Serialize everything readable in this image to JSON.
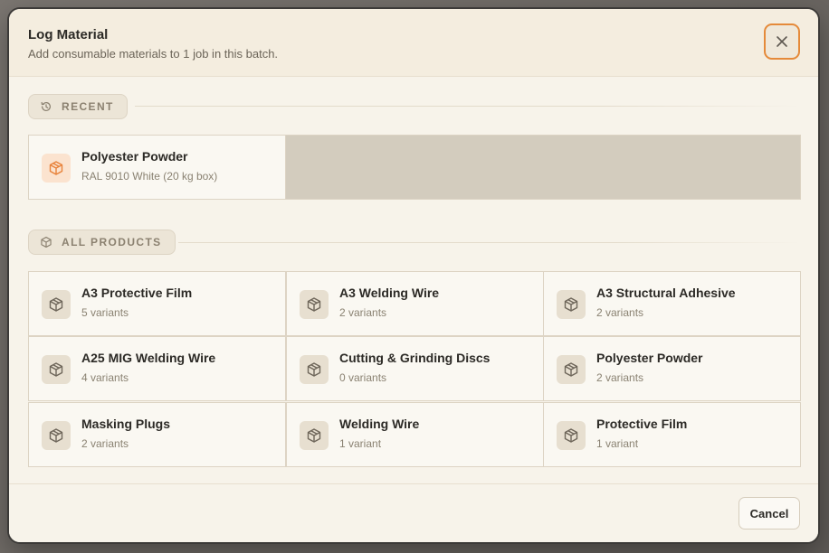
{
  "dialog": {
    "title": "Log Material",
    "subtitle": "Add consumable materials to 1 job in this batch.",
    "close_icon": "close-icon"
  },
  "recent": {
    "label": "RECENT",
    "icon": "history-icon",
    "items": [
      {
        "name": "Polyester Powder",
        "detail": "RAL 9010 White (20 kg box)",
        "icon": "package-icon"
      }
    ]
  },
  "all_products": {
    "label": "ALL PRODUCTS",
    "icon": "package-icon",
    "items": [
      {
        "name": "A3 Protective Film",
        "detail": "5 variants"
      },
      {
        "name": "A3 Welding Wire",
        "detail": "2 variants"
      },
      {
        "name": "A3 Structural Adhesive",
        "detail": "2 variants"
      },
      {
        "name": "A25 MIG Welding Wire",
        "detail": "4 variants"
      },
      {
        "name": "Cutting & Grinding Discs",
        "detail": "0 variants"
      },
      {
        "name": "Polyester Powder",
        "detail": "2 variants"
      },
      {
        "name": "Masking Plugs",
        "detail": "2 variants"
      },
      {
        "name": "Welding Wire",
        "detail": "1 variant"
      },
      {
        "name": "Protective Film",
        "detail": "1 variant"
      }
    ]
  },
  "footer": {
    "cancel_label": "Cancel"
  },
  "colors": {
    "accent": "#e58a3a",
    "recent_icon": "#e8823a",
    "product_icon": "#6e665a"
  }
}
